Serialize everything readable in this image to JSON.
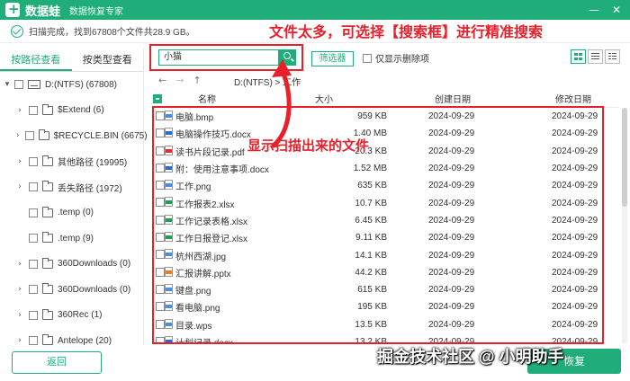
{
  "app": {
    "name": "数据蛙",
    "subtitle": "数据恢复专家"
  },
  "status": {
    "text": "扫描完成，找到67808个文件共28.9 GB。"
  },
  "annotations": {
    "top": "文件太多，可选择【搜索框】进行精准搜索",
    "middle": "显示扫描出来的文件"
  },
  "tabs": [
    {
      "label": "按路径查看"
    },
    {
      "label": "按类型查看"
    }
  ],
  "tree": {
    "root": "D:(NTFS) (67808)",
    "items": [
      {
        "label": "$Extend (6)"
      },
      {
        "label": "$RECYCLE.BIN (6675)"
      },
      {
        "label": "其他路径 (19995)"
      },
      {
        "label": "丢失路径 (1972)"
      },
      {
        "label": ".temp (0)"
      },
      {
        "label": ".temp (9)"
      },
      {
        "label": "360Downloads (0)"
      },
      {
        "label": "360Downloads (0)"
      },
      {
        "label": "360Rec (1)"
      },
      {
        "label": "Antelope (20)"
      }
    ]
  },
  "toolbar": {
    "search_value": "小猫",
    "filter_label": "筛选器",
    "deleted_only_label": "仅显示删除项"
  },
  "nav": {
    "path": "D:(NTFS) > 工作"
  },
  "table": {
    "headers": {
      "name": "名称",
      "size": "大小",
      "created": "创建日期",
      "modified": "修改日期"
    },
    "rows": [
      {
        "name": "电脑.bmp",
        "size": "959 KB",
        "created": "2024-09-29",
        "modified": "2024-09-29",
        "icon": "image-file-icon",
        "color": "#4c8fd6"
      },
      {
        "name": "电脑操作技巧.docx",
        "size": "1.40 MB",
        "created": "2024-09-29",
        "modified": "2024-09-29",
        "icon": "word-file-icon",
        "color": "#2b6bc9"
      },
      {
        "name": "读书片段记录.pdf",
        "size": "20.3 KB",
        "created": "2024-09-29",
        "modified": "2024-09-29",
        "icon": "pdf-file-icon",
        "color": "#d8322d"
      },
      {
        "name": "附：使用注意事项.docx",
        "size": "1.52 MB",
        "created": "2024-09-29",
        "modified": "2024-09-29",
        "icon": "word-file-icon",
        "color": "#2b6bc9"
      },
      {
        "name": "工作.png",
        "size": "635 KB",
        "created": "2024-09-29",
        "modified": "2024-09-29",
        "icon": "image-file-icon",
        "color": "#4c8fd6"
      },
      {
        "name": "工作报表2.xlsx",
        "size": "10.7 KB",
        "created": "2024-09-29",
        "modified": "2024-09-29",
        "icon": "excel-file-icon",
        "color": "#1f9d55"
      },
      {
        "name": "工作记录表格.xlsx",
        "size": "6.45 KB",
        "created": "2024-09-29",
        "modified": "2024-09-29",
        "icon": "excel-file-icon",
        "color": "#1f9d55"
      },
      {
        "name": "工作日报登记.xlsx",
        "size": "9.11 KB",
        "created": "2024-09-29",
        "modified": "2024-09-29",
        "icon": "excel-file-icon",
        "color": "#1f9d55"
      },
      {
        "name": "杭州西湖.jpg",
        "size": "14.1 KB",
        "created": "2024-09-29",
        "modified": "2024-09-29",
        "icon": "image-file-icon",
        "color": "#4c8fd6"
      },
      {
        "name": "汇报讲解.pptx",
        "size": "44.2 KB",
        "created": "2024-09-29",
        "modified": "2024-09-29",
        "icon": "ppt-file-icon",
        "color": "#e67e22"
      },
      {
        "name": "键盘.png",
        "size": "615 KB",
        "created": "2024-09-29",
        "modified": "2024-09-29",
        "icon": "image-file-icon",
        "color": "#4c8fd6"
      },
      {
        "name": "看电脑.png",
        "size": "195 KB",
        "created": "2024-09-29",
        "modified": "2024-09-29",
        "icon": "image-file-icon",
        "color": "#4c8fd6"
      },
      {
        "name": "目录.wps",
        "size": "13.5 KB",
        "created": "2024-09-29",
        "modified": "2024-09-29",
        "icon": "wps-file-icon",
        "color": "#4c8fd6"
      },
      {
        "name": "计划记录.docx",
        "size": "13.2 KB",
        "created": "2024-09-29",
        "modified": "2024-09-29",
        "icon": "word-file-icon",
        "color": "#2b6bc9"
      }
    ]
  },
  "buttons": {
    "back": "返回",
    "recover": "恢复"
  },
  "watermark": "掘金技术社区 @ 小明助手",
  "colors": {
    "brand": "#1fae7a",
    "annotation": "#e8202a"
  }
}
